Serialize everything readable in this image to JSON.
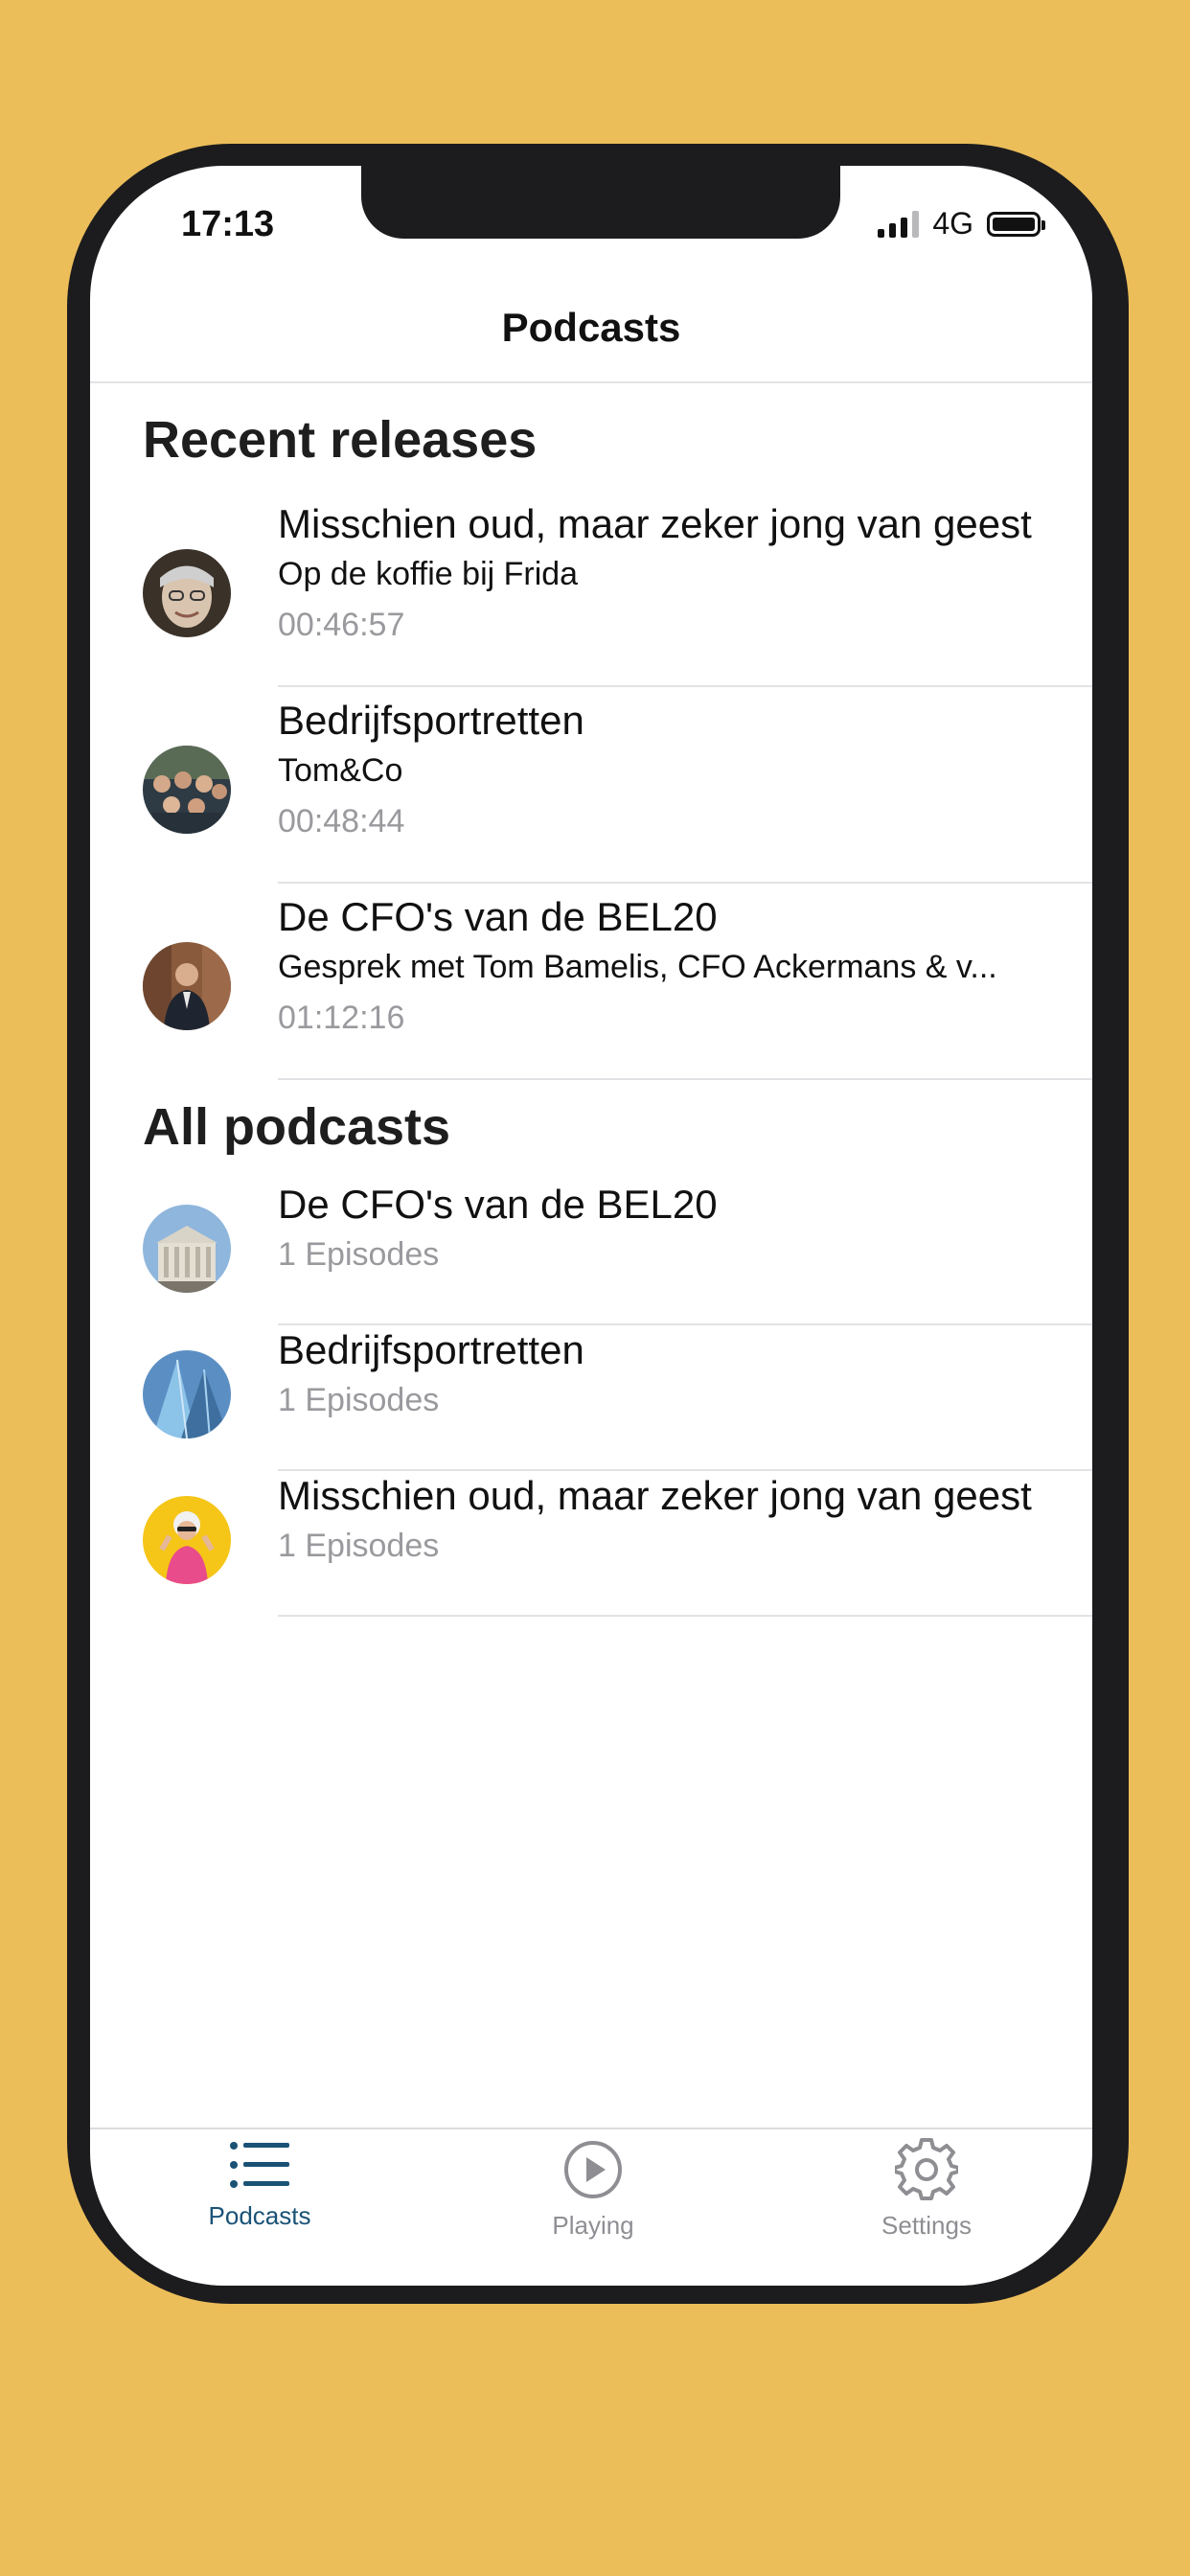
{
  "status_bar": {
    "time": "17:13",
    "network": "4G"
  },
  "nav": {
    "title": "Podcasts"
  },
  "recent": {
    "header": "Recent releases",
    "items": [
      {
        "title": "Misschien oud, maar zeker jong van geest",
        "subtitle": "Op de koffie bij Frida",
        "duration": "00:46:57"
      },
      {
        "title": "Bedrijfsportretten",
        "subtitle": "Tom&Co",
        "duration": "00:48:44"
      },
      {
        "title": "De CFO's van de BEL20",
        "subtitle": "Gesprek met Tom Bamelis, CFO Ackermans & v...",
        "duration": "01:12:16"
      }
    ]
  },
  "all": {
    "header": "All podcasts",
    "items": [
      {
        "title": "De CFO's van de BEL20",
        "episodes": "1 Episodes"
      },
      {
        "title": "Bedrijfsportretten",
        "episodes": "1 Episodes"
      },
      {
        "title": "Misschien oud, maar zeker jong van geest",
        "episodes": "1 Episodes"
      }
    ]
  },
  "tabbar": {
    "tabs": [
      {
        "label": "Podcasts",
        "icon": "list-icon"
      },
      {
        "label": "Playing",
        "icon": "play-circle-icon"
      },
      {
        "label": "Settings",
        "icon": "gear-icon"
      }
    ],
    "active_color": "#1a5276",
    "inactive_color": "#8e8e93"
  },
  "colors": {
    "background": "#ECBE5A",
    "frame": "#1c1c1e"
  }
}
